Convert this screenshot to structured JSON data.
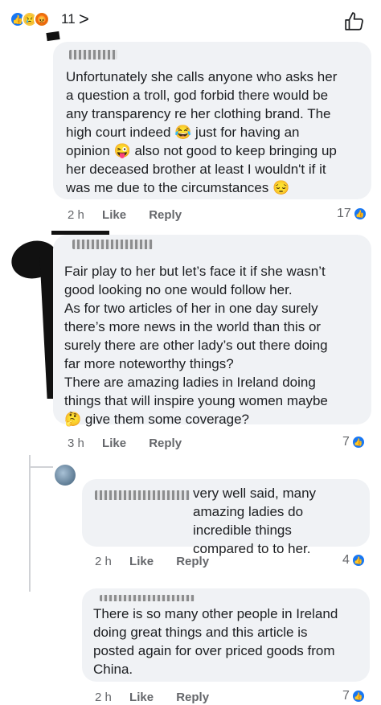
{
  "top_bar": {
    "reaction_count": "11",
    "chevron": ">",
    "like_icon": "thumbs-up-icon"
  },
  "comments": [
    {
      "name": "D.K...",
      "text": "Unfortunately she calls anyone who asks her\na question a troll, god forbid there would be\nany transparency re her clothing brand. The\nhigh court indeed 😂 just for having an\nopinion 😜 also not good to keep bringing up\nher deceased brother at least I wouldn't if it\nwas me due to the circumstances 😔",
      "time": "2 h",
      "like": "Like",
      "reply": "Reply",
      "reactions": "17"
    },
    {
      "name": "...",
      "text": "Fair play to her but let’s face it if she wasn’t\ngood looking no one would follow her.\nAs for two articles of her in one day surely\nthere’s more news in the world than this or\nsurely there are other lady’s out there doing\nfar more noteworthy things?\nThere are amazing ladies in Ireland doing\nthings that will inspire young women maybe\n🤔 give them some coverage?",
      "time": "3 h",
      "like": "Like",
      "reply": "Reply",
      "reactions": "7"
    }
  ],
  "replies": [
    {
      "text": "very well said, many\namazing ladies do incredible things\ncompared to to her.",
      "time": "2 h",
      "like": "Like",
      "reply": "Reply",
      "reactions": "4"
    },
    {
      "text": "There is so many other people in Ireland\ndoing great things and this article is\nposted again for over priced goods from\nChina.",
      "time": "2 h",
      "like": "Like",
      "reply": "Reply",
      "reactions": "7"
    }
  ]
}
